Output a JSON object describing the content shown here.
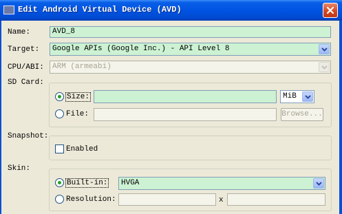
{
  "window": {
    "title": "Edit Android Virtual Device (AVD)",
    "app_icon": "android-window-icon",
    "close_icon": "close-icon"
  },
  "form": {
    "name": {
      "label": "Name:",
      "value": "AVD_8"
    },
    "target": {
      "label": "Target:",
      "value": "Google APIs (Google Inc.) - API Level 8"
    },
    "cpu_abi": {
      "label": "CPU/ABI:",
      "value": "ARM (armeabi)"
    },
    "sd_card": {
      "label": "SD Card:",
      "size_label": "Size:",
      "size_value": "",
      "size_unit": "MiB",
      "file_label": "File:",
      "file_value": "",
      "browse_label": "Browse...",
      "selected": "size"
    },
    "snapshot": {
      "label": "Snapshot:",
      "enabled_label": "Enabled",
      "enabled": false
    },
    "skin": {
      "label": "Skin:",
      "builtin_label": "Built-in:",
      "builtin_value": "HVGA",
      "resolution_label": "Resolution:",
      "resolution_width": "",
      "separator": "x",
      "resolution_height": "",
      "selected": "builtin"
    }
  },
  "colors": {
    "title_bar": "#0054e3",
    "dialog_background": "#ece9d8",
    "field_highlight": "#ccf2d3",
    "close_button": "#d2451b"
  }
}
